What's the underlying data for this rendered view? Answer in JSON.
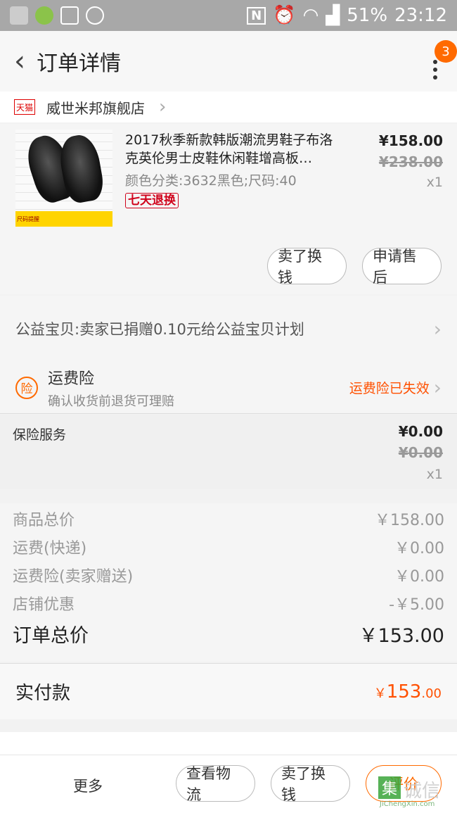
{
  "status_bar": {
    "nfc": "N",
    "battery": "51%",
    "time": "23:12"
  },
  "header": {
    "title": "订单详情",
    "badge_count": "3"
  },
  "shop": {
    "badge": "天猫",
    "name": "威世米邦旗舰店"
  },
  "product": {
    "title": "2017秋季新款韩版潮流男鞋子布洛克英伦男士皮鞋休闲鞋增高板…",
    "sku": "颜色分类:3632黑色;尺码:40",
    "tag": "七天退换",
    "price": "¥158.00",
    "original_price": "¥238.00",
    "quantity": "x1",
    "thumb_strip": "尺码提醒",
    "actions": [
      "卖了换钱",
      "申请售后"
    ]
  },
  "charity": {
    "text": "公益宝贝:卖家已捐赠0.10元给公益宝贝计划"
  },
  "shipping_insurance": {
    "icon_text": "险",
    "title": "运费险",
    "subtitle": "确认收货前退货可理赔",
    "status": "运费险已失效",
    "status_color": "#ff5000"
  },
  "insurance_service": {
    "label": "保险服务",
    "price": "¥0.00",
    "original_price": "¥0.00",
    "quantity": "x1"
  },
  "summary": [
    {
      "label": "商品总价",
      "value": "￥158.00"
    },
    {
      "label": "运费(快递)",
      "value": "￥0.00"
    },
    {
      "label": "运费险(卖家赠送)",
      "value": "￥0.00"
    },
    {
      "label": "店铺优惠",
      "value": "-￥5.00"
    }
  ],
  "order_total": {
    "label": "订单总价",
    "value": "￥153.00"
  },
  "paid": {
    "label": "实付款",
    "currency": "￥",
    "integer": "153",
    "decimal": ".00"
  },
  "bottom_bar": {
    "more": "更多",
    "buttons": [
      "查看物流",
      "卖了换钱",
      "评价"
    ]
  },
  "watermark": {
    "box": "集",
    "text": "诚信",
    "url": "JiChengXin.com"
  },
  "colors": {
    "accent": "#ff6a00",
    "price_red": "#ff5000",
    "tag_red": "#d0021b"
  }
}
